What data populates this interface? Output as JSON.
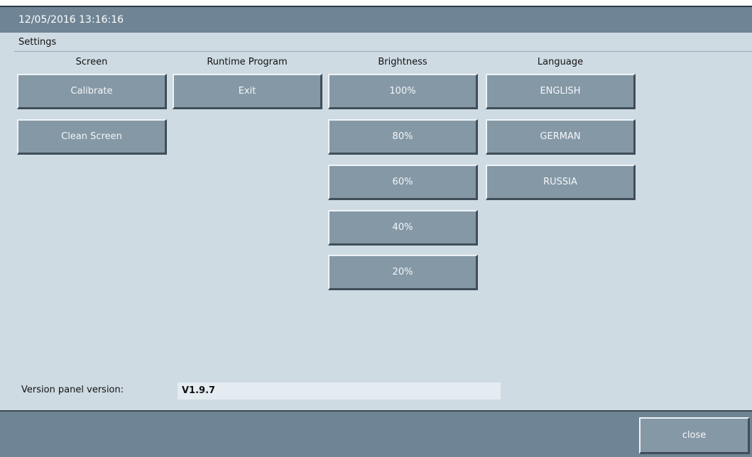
{
  "header": {
    "datetime": "12/05/2016 13:16:16"
  },
  "page": {
    "title": "Settings"
  },
  "columns": {
    "screen": {
      "heading": "Screen",
      "buttons": [
        "Calibrate",
        "Clean Screen"
      ]
    },
    "runtime": {
      "heading": "Runtime Program",
      "buttons": [
        "Exit"
      ]
    },
    "brightness": {
      "heading": "Brightness",
      "buttons": [
        "100%",
        "80%",
        "60%",
        "40%",
        "20%"
      ]
    },
    "language": {
      "heading": "Language",
      "buttons": [
        "ENGLISH",
        "GERMAN",
        "RUSSIA"
      ]
    }
  },
  "version": {
    "label": "Version panel version:",
    "value": "V1.9.7"
  },
  "footer": {
    "close_label": "close"
  },
  "colors": {
    "titlebar": "#6f8595",
    "background": "#cfdbe3",
    "button": "#8598a6"
  }
}
